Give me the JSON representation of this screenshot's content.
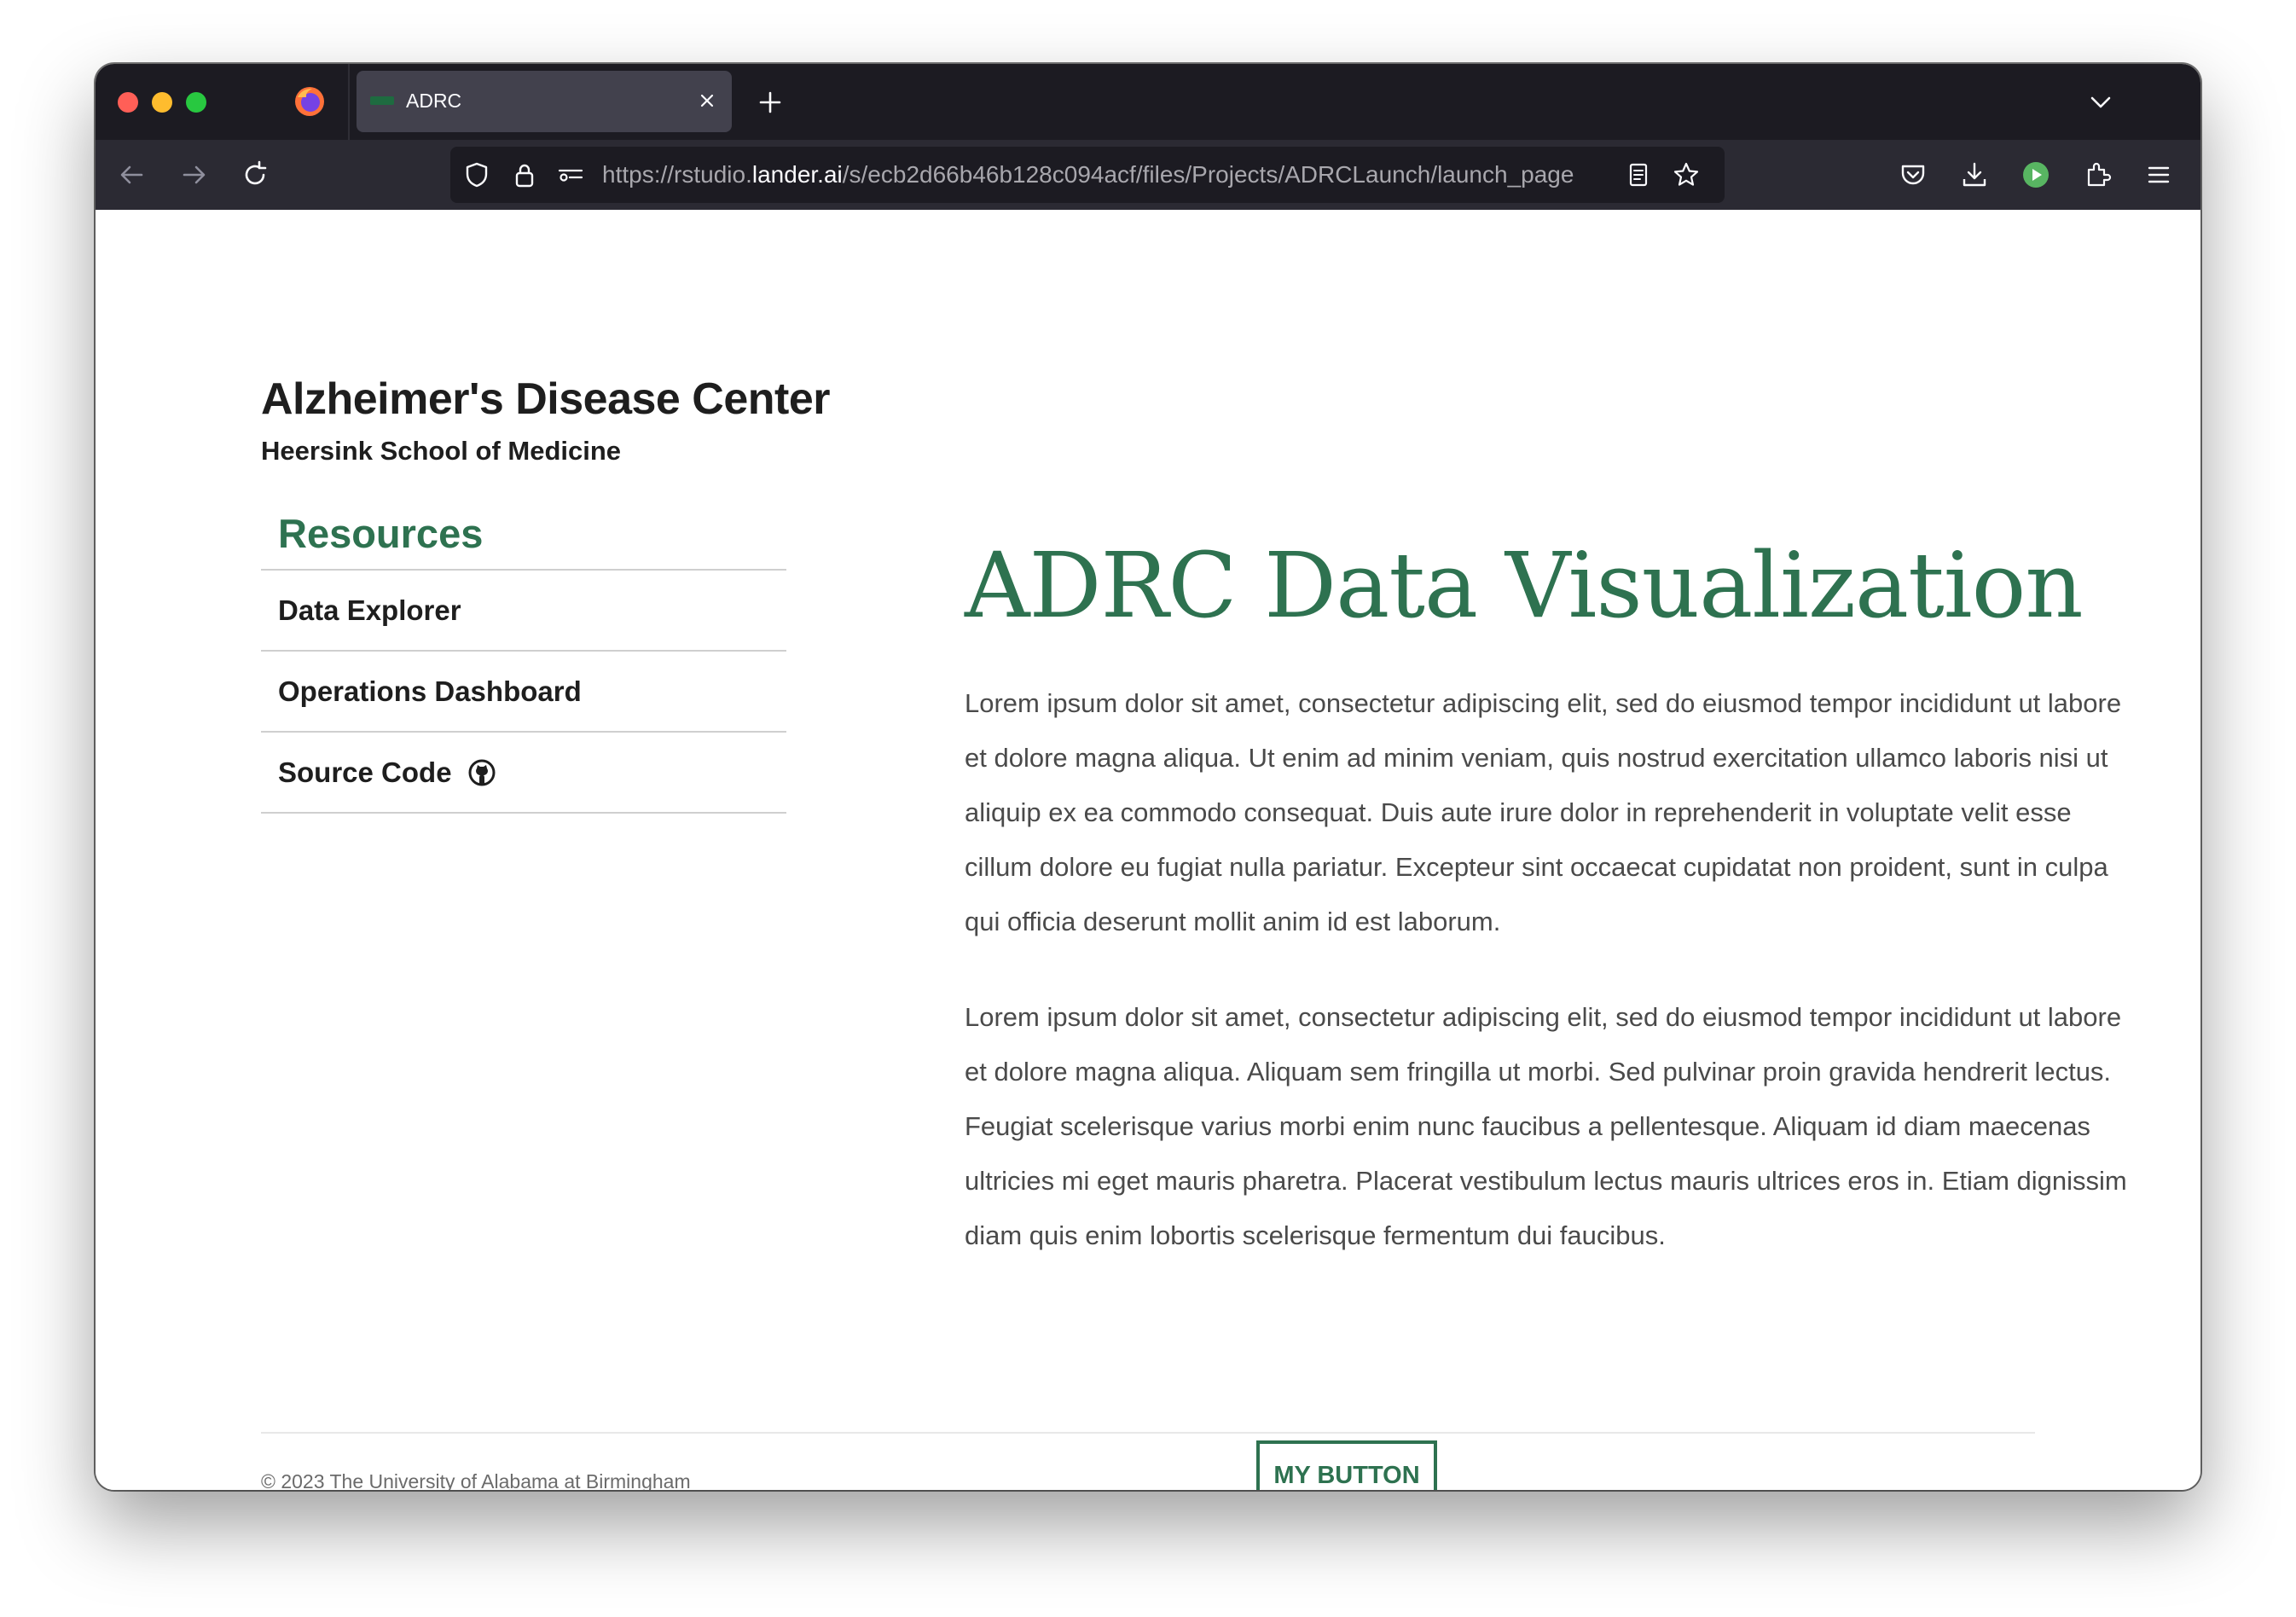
{
  "browser": {
    "tab_title": "ADRC",
    "url_prefix": "https://rstudio.",
    "url_host": "lander.ai",
    "url_path": "/s/ecb2d66b46b128c094acf/files/Projects/ADRCLaunch/launch_page",
    "icons": {
      "back": "back-arrow-icon",
      "forward": "forward-arrow-icon",
      "reload": "reload-icon",
      "shield": "tracking-protection-shield-icon",
      "lock": "lock-icon",
      "permissions": "permissions-icon",
      "reader": "reader-view-icon",
      "bookmark": "bookmark-star-icon",
      "pocket": "pocket-icon",
      "downloads": "download-icon",
      "extension": "extension-play-icon",
      "extensions": "puzzle-extensions-icon",
      "menu": "hamburger-menu-icon"
    }
  },
  "site": {
    "title": "Alzheimer's Disease Center",
    "subtitle": "Heersink School of Medicine"
  },
  "sidebar": {
    "heading": "Resources",
    "items": [
      {
        "label": "Data Explorer"
      },
      {
        "label": "Operations Dashboard"
      },
      {
        "label": "Source Code",
        "icon": "github-icon"
      }
    ]
  },
  "main": {
    "title": "ADRC Data Visualization",
    "paragraph_1": "Lorem ipsum dolor sit amet, consectetur adipiscing elit, sed do eiusmod tempor incididunt ut labore et dolore magna aliqua. Ut enim ad minim veniam, quis nostrud exercitation ullamco laboris nisi ut aliquip ex ea commodo consequat. Duis aute irure dolor in reprehenderit in voluptate velit esse cillum dolore eu fugiat nulla pariatur. Excepteur sint occaecat cupidatat non proident, sunt in culpa qui officia deserunt mollit anim id est laborum.",
    "paragraph_2": "Lorem ipsum dolor sit amet, consectetur adipiscing elit, sed do eiusmod tempor incididunt ut labore et dolore magna aliqua. Aliquam sem fringilla ut morbi. Sed pulvinar proin gravida hendrerit lectus. Feugiat scelerisque varius morbi enim nunc faucibus a pellentesque. Aliquam id diam maecenas ultricies mi eget mauris pharetra. Placerat vestibulum lectus mauris ultrices eros in. Etiam dignissim diam quis enim lobortis scelerisque fermentum dui faucibus.",
    "button_label": "MY BUTTON"
  },
  "footer": {
    "text": "© 2023 The University of Alabama at Birmingham"
  },
  "colors": {
    "accent_green": "#2e7250",
    "browser_dark": "#1c1b22",
    "browser_toolbar": "#2b2a33"
  }
}
